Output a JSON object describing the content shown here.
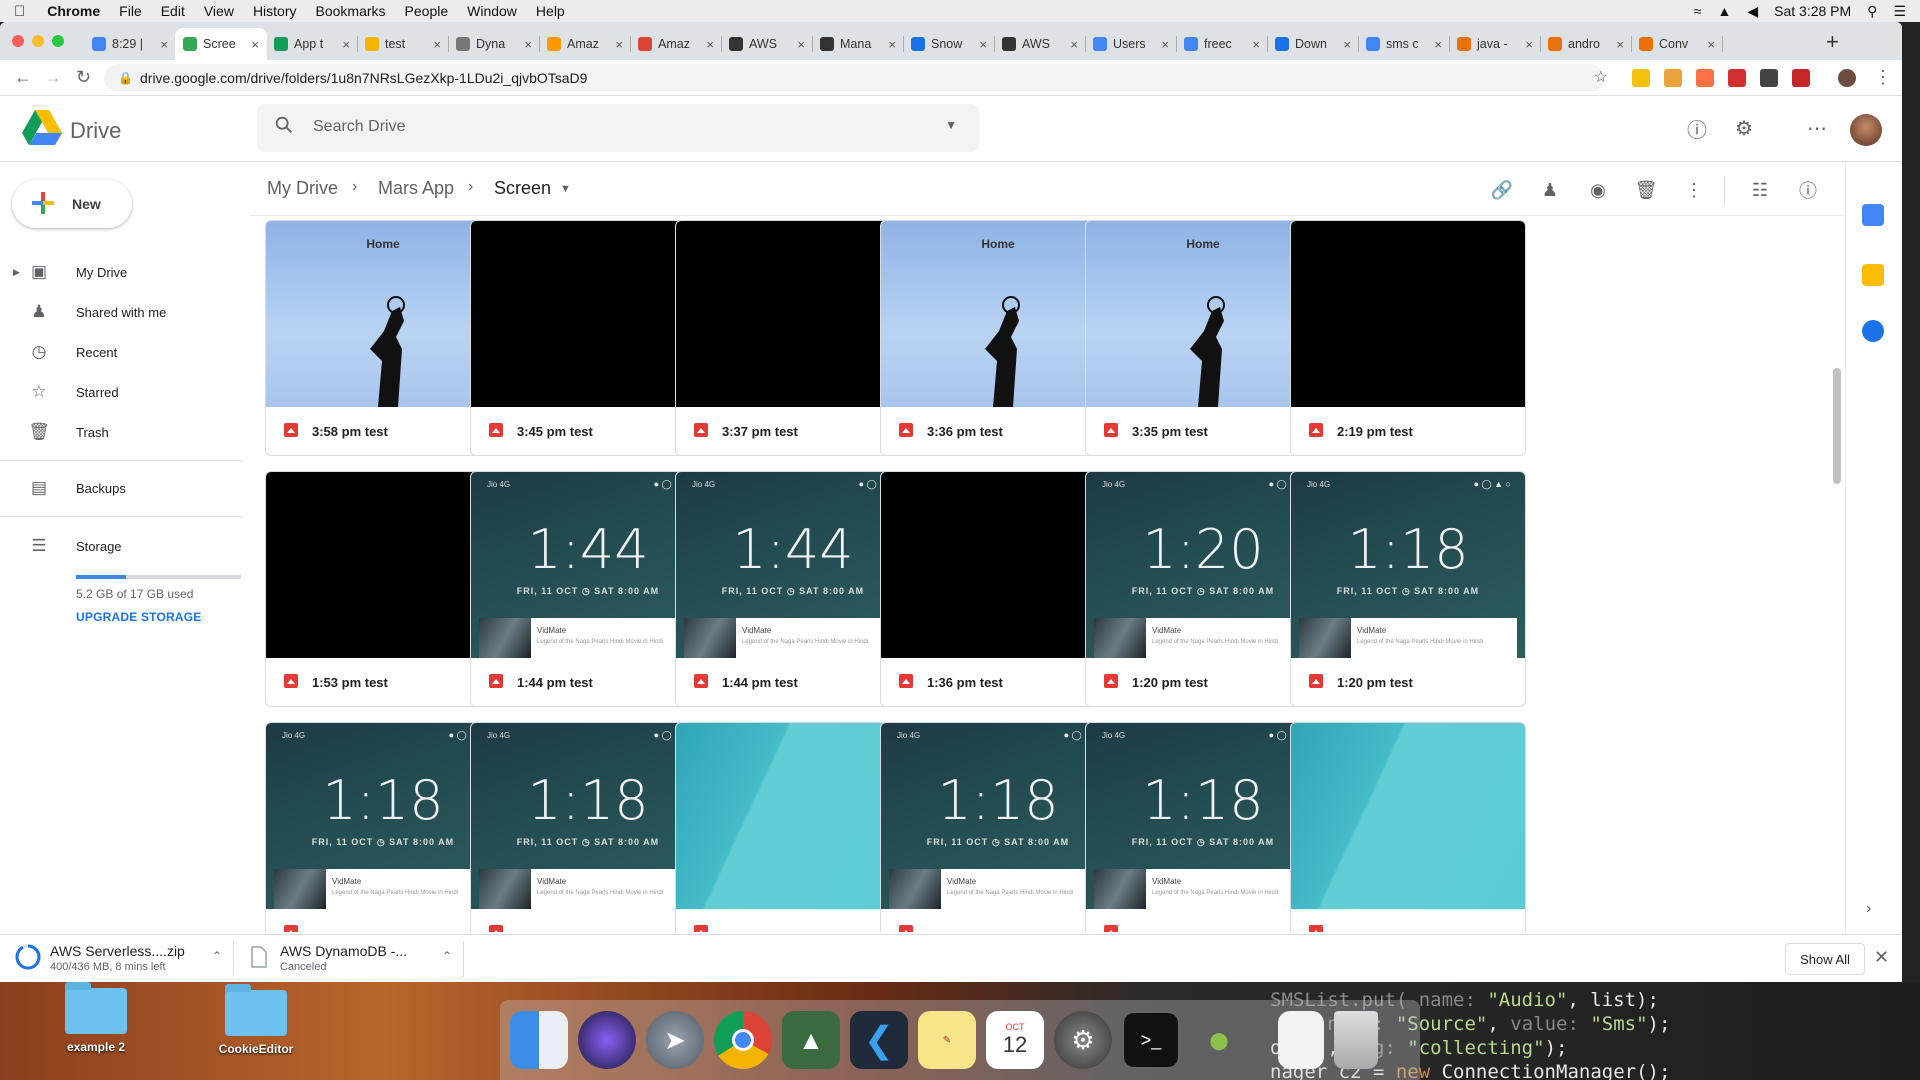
{
  "menubar": {
    "app": "Chrome",
    "items": [
      "File",
      "Edit",
      "View",
      "History",
      "Bookmarks",
      "People",
      "Window",
      "Help"
    ],
    "clock": "Sat 3:28 PM"
  },
  "tabs": [
    {
      "label": "8:29 |",
      "color": "#4285f4"
    },
    {
      "label": "Scree",
      "color": "#34a853",
      "active": true
    },
    {
      "label": "App t",
      "color": "#0f9d58"
    },
    {
      "label": "test",
      "color": "#f4b400"
    },
    {
      "label": "Dyna",
      "color": "#777777"
    },
    {
      "label": "Amaz",
      "color": "#ff9900"
    },
    {
      "label": "Amaz",
      "color": "#db4437"
    },
    {
      "label": "AWS",
      "color": "#333333"
    },
    {
      "label": "Mana",
      "color": "#333333"
    },
    {
      "label": "Snow",
      "color": "#1a73e8"
    },
    {
      "label": "AWS",
      "color": "#333333"
    },
    {
      "label": "Users",
      "color": "#4285f4"
    },
    {
      "label": "freec",
      "color": "#4285f4"
    },
    {
      "label": "Down",
      "color": "#1a73e8"
    },
    {
      "label": "sms c",
      "color": "#4285f4"
    },
    {
      "label": "java -",
      "color": "#e8710a"
    },
    {
      "label": "andro",
      "color": "#e8710a"
    },
    {
      "label": "Conv",
      "color": "#e8710a"
    }
  ],
  "url": "drive.google.com/drive/folders/1u8n7NRsLGezXkp-1LDu2i_qjvbOTsaD9",
  "drive": {
    "logo_text": "Drive",
    "search_placeholder": "Search Drive",
    "new_label": "New",
    "nav": [
      {
        "label": "My Drive",
        "icon": "my-drive-icon"
      },
      {
        "label": "Shared with me",
        "icon": "shared-icon"
      },
      {
        "label": "Recent",
        "icon": "clock-icon"
      },
      {
        "label": "Starred",
        "icon": "star-icon"
      },
      {
        "label": "Trash",
        "icon": "trash-icon"
      },
      {
        "label": "Backups",
        "icon": "backups-icon"
      },
      {
        "label": "Storage",
        "icon": "storage-icon"
      }
    ],
    "storage_used": "5.2 GB of 17 GB used",
    "storage_fraction": 0.306,
    "upgrade_label": "UPGRADE STORAGE",
    "breadcrumb": [
      "My Drive",
      "Mars App",
      "Screen"
    ]
  },
  "files": [
    {
      "name": "3:58 pm test",
      "thumb": "home"
    },
    {
      "name": "3:45 pm test",
      "thumb": "black"
    },
    {
      "name": "3:37 pm test",
      "thumb": "black"
    },
    {
      "name": "3:36 pm test",
      "thumb": "home"
    },
    {
      "name": "3:35 pm test",
      "thumb": "home"
    },
    {
      "name": "2:19 pm test",
      "thumb": "black"
    },
    {
      "name": "1:53 pm test",
      "thumb": "black"
    },
    {
      "name": "1:44 pm test",
      "thumb": "lock",
      "time": "1:44"
    },
    {
      "name": "1:44 pm test",
      "thumb": "lock",
      "time": "1:44"
    },
    {
      "name": "1:36 pm test",
      "thumb": "black"
    },
    {
      "name": "1:20 pm test",
      "thumb": "lock",
      "time": "1:20"
    },
    {
      "name": "1:20 pm test",
      "thumb": "lock",
      "time": "1:18"
    },
    {
      "name": "",
      "thumb": "lock",
      "time": "1:18"
    },
    {
      "name": "",
      "thumb": "lock",
      "time": "1:18"
    },
    {
      "name": "",
      "thumb": "teal"
    },
    {
      "name": "",
      "thumb": "lock",
      "time": "1:18"
    },
    {
      "name": "",
      "thumb": "lock",
      "time": "1:18"
    },
    {
      "name": "",
      "thumb": "teal"
    }
  ],
  "lockscreen": {
    "carrier": "Jio 4G",
    "date": "FRI, 11 OCT",
    "alarm": "SAT 8:00 AM",
    "notif_title": "VidMate",
    "notif_text": "Legend of the Naga Pearls Hindi Movie in Hindi"
  },
  "home_thumb_title": "Home",
  "downloads": [
    {
      "name": "AWS Serverless....zip",
      "status": "400/436 MB, 8 mins left"
    },
    {
      "name": "AWS DynamoDB -...",
      "status": "Canceled"
    }
  ],
  "show_all": "Show All",
  "desktop": {
    "folders": [
      "example 2",
      "CookieEditor"
    ],
    "calendar_month": "OCT",
    "calendar_day": "12"
  }
}
